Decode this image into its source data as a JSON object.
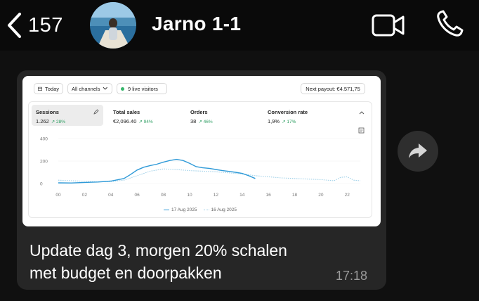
{
  "header": {
    "back_count": "157",
    "chat_title": "Jarno 1-1"
  },
  "message": {
    "text_line1": "Update dag 3, morgen 20% schalen",
    "text_line2": "met budget en doorpakken",
    "time": "17:18"
  },
  "dashboard": {
    "date_filter": "Today",
    "channel_filter": "All channels",
    "live_visitors": "9 live visitors",
    "next_payout": "Next payout: €4.571,75",
    "metrics": [
      {
        "label": "Sessions",
        "value": "1.262",
        "change": "↗ 28%"
      },
      {
        "label": "Total sales",
        "value": "€2,096.40",
        "change": "↗ 94%"
      },
      {
        "label": "Orders",
        "value": "38",
        "change": "↗ 46%"
      },
      {
        "label": "Conversion rate",
        "value": "1,9%",
        "change": "↗ 17%"
      }
    ],
    "legend_current": "17 Aug 2025",
    "legend_previous": "16 Aug 2025"
  },
  "colors": {
    "current_series": "#2f9ad8",
    "previous_series": "#9fd0e8",
    "change_positive": "#2e9e62"
  },
  "chart_data": {
    "type": "line",
    "ylim": [
      0,
      400
    ],
    "y_ticks": [
      "0",
      "200",
      "400"
    ],
    "x_ticks": [
      "00",
      "02",
      "04",
      "06",
      "08",
      "10",
      "12",
      "14",
      "16",
      "18",
      "20",
      "22"
    ],
    "series": [
      {
        "name": "17 Aug 2025",
        "x": [
          0,
          1,
          2,
          3,
          4,
          5,
          5.5,
          6,
          6.5,
          7,
          7.5,
          8,
          8.5,
          9,
          9.5,
          10,
          10.5,
          11,
          11.5,
          12,
          12.5,
          13,
          13.5,
          14,
          14.5,
          15
        ],
        "y": [
          6,
          5,
          10,
          14,
          22,
          45,
          80,
          120,
          145,
          160,
          172,
          190,
          205,
          215,
          205,
          180,
          150,
          140,
          135,
          125,
          115,
          108,
          100,
          90,
          70,
          45
        ]
      },
      {
        "name": "16 Aug 2025",
        "x": [
          0,
          1,
          2,
          3,
          4,
          5,
          6,
          7,
          8,
          9,
          10,
          11,
          12,
          13,
          14,
          15,
          16,
          17,
          18,
          19,
          20,
          21,
          21.5,
          22,
          22.5,
          23
        ],
        "y": [
          30,
          25,
          20,
          15,
          18,
          30,
          70,
          110,
          130,
          125,
          115,
          110,
          105,
          95,
          85,
          70,
          60,
          50,
          45,
          40,
          35,
          25,
          55,
          60,
          30,
          25
        ]
      }
    ]
  }
}
